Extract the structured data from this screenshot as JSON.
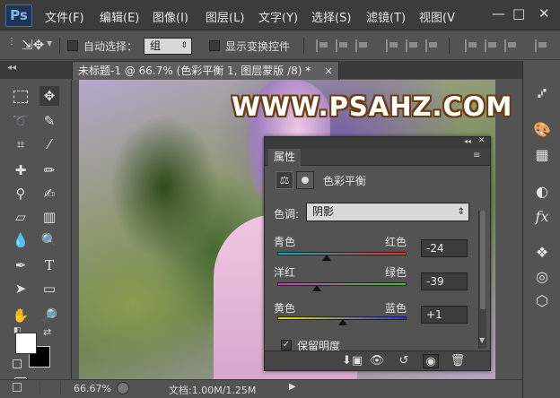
{
  "app": {
    "logo": "Ps"
  },
  "menu": [
    "文件(F)",
    "编辑(E)",
    "图像(I)",
    "图层(L)",
    "文字(Y)",
    "选择(S)",
    "滤镜(T)",
    "视图(V"
  ],
  "window_controls": {
    "minimize": "—",
    "restore": "□",
    "close": "✕"
  },
  "options": {
    "auto_select_label": "自动选择：",
    "auto_select_value": "组",
    "show_transform_label": "显示变换控件"
  },
  "document": {
    "tab_title": "未标题-1 @ 66.7% (色彩平衡 1, 图层蒙版 /8) *",
    "tab_close": "×"
  },
  "canvas": {
    "watermark": "WWW.PSAHZ.COM"
  },
  "status": {
    "zoom": "66.67%",
    "doc_size": "文档:1.00M/1.25M"
  },
  "properties": {
    "tab": "属性",
    "title": "色彩平衡",
    "tone_label": "色调:",
    "tone_value": "阴影",
    "sliders": [
      {
        "left": "青色",
        "right": "红色",
        "value": "-24",
        "fraction": 0.38
      },
      {
        "left": "洋红",
        "right": "绿色",
        "value": "-39",
        "fraction": 0.305
      },
      {
        "left": "黄色",
        "right": "蓝色",
        "value": "+1",
        "fraction": 0.505
      }
    ],
    "preserve_luminosity": "保留明度",
    "preserve_checked": true
  },
  "colors": {
    "accent": "#1d3552",
    "panel_bg": "#535353",
    "menubar_bg": "#3c3c3c"
  }
}
